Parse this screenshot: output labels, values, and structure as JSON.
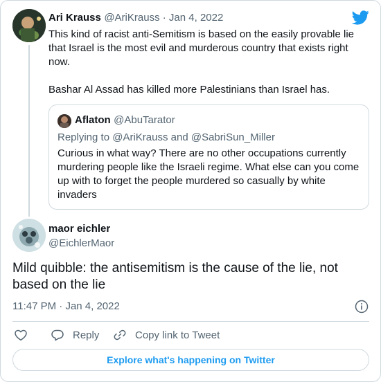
{
  "colors": {
    "accent": "#1d9bf0",
    "text": "#0f1419",
    "muted": "#536471",
    "border": "#cfd9de"
  },
  "parent_tweet": {
    "author_name": "Ari Krauss",
    "author_handle": "@AriKrauss",
    "separator": " · ",
    "date": "Jan 4, 2022",
    "text_para1": "This kind of racist anti-Semitism is based on the easily provable lie that Israel is the most evil and murderous country that exists right now.",
    "text_para2": "Bashar Al Assad has killed more Palestinians than Israel has.",
    "quoted": {
      "author_name": "Aflaton",
      "author_handle": "@AbuTarator",
      "reply_prefix": "Replying to",
      "reply_user1": "@AriKrauss",
      "reply_and": "and",
      "reply_user2": "@SabriSun_Miller",
      "text": "Curious in what way? There are no other occupations currently murdering people like the Israeli regime. What else can you come up with to forget the people murdered so casually by white invaders"
    }
  },
  "main_tweet": {
    "author_name": "maor eichler",
    "author_handle": "@EichlerMaor",
    "text": "Mild quibble: the antisemitism is the cause of the lie, not based on the lie",
    "time": "11:47 PM",
    "separator": " · ",
    "date": "Jan 4, 2022"
  },
  "actions": {
    "reply_label": "Reply",
    "copy_link_label": "Copy link to Tweet"
  },
  "explore_label": "Explore what's happening on Twitter",
  "icons": {
    "logo": "twitter-bird-icon",
    "like": "heart-icon",
    "reply": "speech-bubble-icon",
    "copy": "link-icon",
    "info": "info-icon"
  }
}
